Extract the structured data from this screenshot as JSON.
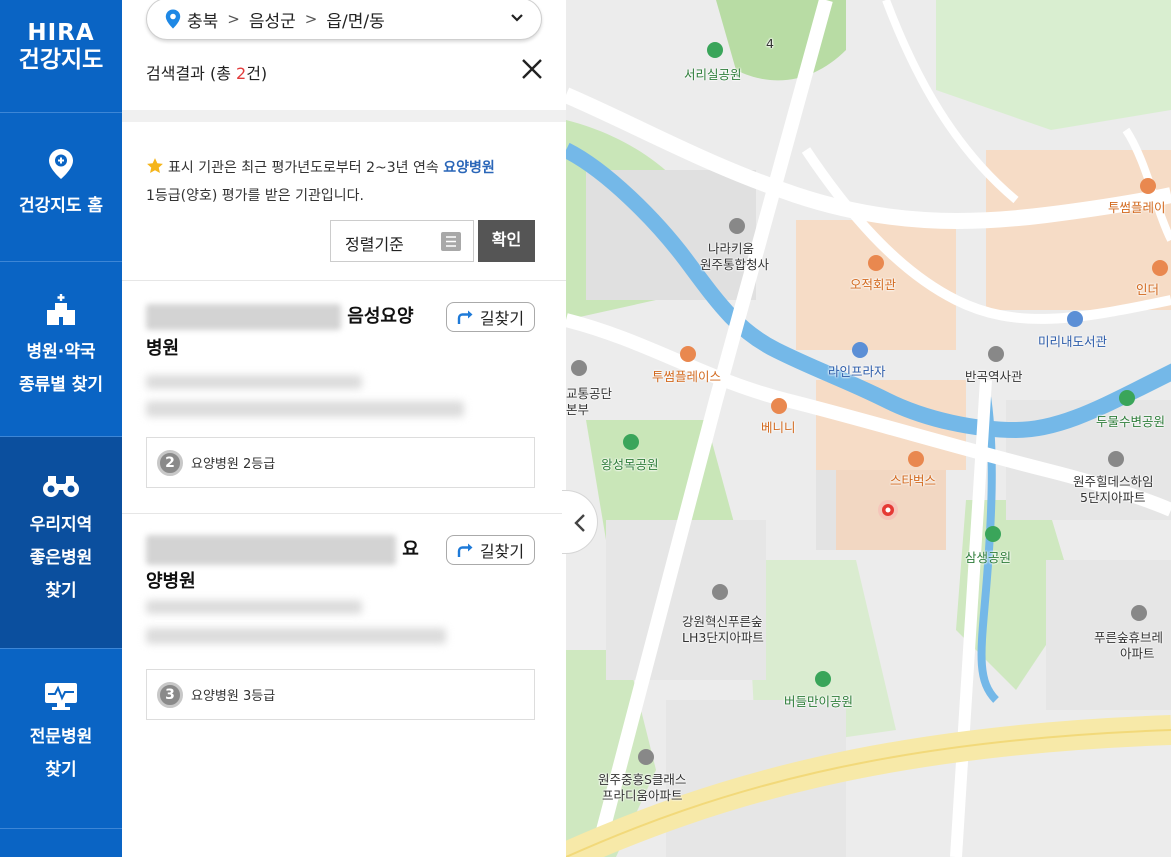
{
  "logo": {
    "line1": "HIRA",
    "line2": "건강지도"
  },
  "nav": {
    "home": "건강지도 홈",
    "hospital_type_1": "병원·약국",
    "hospital_type_2": "종류별 찾기",
    "good_1": "우리지역",
    "good_2": "좋은병원",
    "good_3": "찾기",
    "special_1": "전문병원",
    "special_2": "찾기"
  },
  "location": {
    "province": "충북",
    "district": "음성군",
    "town": "읍/면/동"
  },
  "results": {
    "prefix": "검색결과 (총 ",
    "count": "2",
    "suffix": "건)"
  },
  "notice": {
    "text1": "표시 기관은 최근 평가년도로부터 2~3년 연속 ",
    "highlight": "요양병원",
    "text2": "1등급(양호) 평가를 받은 기관입니다."
  },
  "sort": {
    "label": "정렬기준",
    "confirm": "확인"
  },
  "cards": [
    {
      "name_visible": "음성요양",
      "name_line2": "병원",
      "directions": "길찾기",
      "grade_num": "2",
      "grade_text": "요양병원  2등급"
    },
    {
      "name_visible": "요",
      "name_line2": "양병원",
      "directions": "길찾기",
      "grade_num": "3",
      "grade_text": "요양병원  3등급"
    }
  ],
  "map_labels": {
    "seorisil": "서리실공원",
    "narakium": "나라키움",
    "tonghap": "원주통합청사",
    "ojeok": "오적회관",
    "twosome1": "투썸플레이",
    "inder": "인더",
    "mirinae": "미리내도서관",
    "banggok": "반곡역사관",
    "line_plaza": "라인프라자",
    "twosome2": "투썸플레이스",
    "gyotong1": "교통공단",
    "gyotong2": "본부",
    "benini": "베니니",
    "wangseong": "왕성목공원",
    "dumul": "두물수변공원",
    "starbucks": "스타벅스",
    "hills1": "원주힐데스하임",
    "hills2": "5단지아파트",
    "samsaeng": "삼생공원",
    "gangwon1": "강원혁신푸른숲",
    "gangwon2": "LH3단지아파트",
    "pureun1": "푸른숲휴브레",
    "pureun2": "아파트",
    "beodeul": "버들만이공원",
    "junghung1": "원주중흥S클래스",
    "junghung2": "프라디움아파트",
    "num4": "4"
  },
  "colors": {
    "nav_blue": "#0a64c4",
    "nav_active": "#0b4f9e",
    "accent_red": "#e23b3b",
    "highlight_blue": "#2a66b8"
  }
}
